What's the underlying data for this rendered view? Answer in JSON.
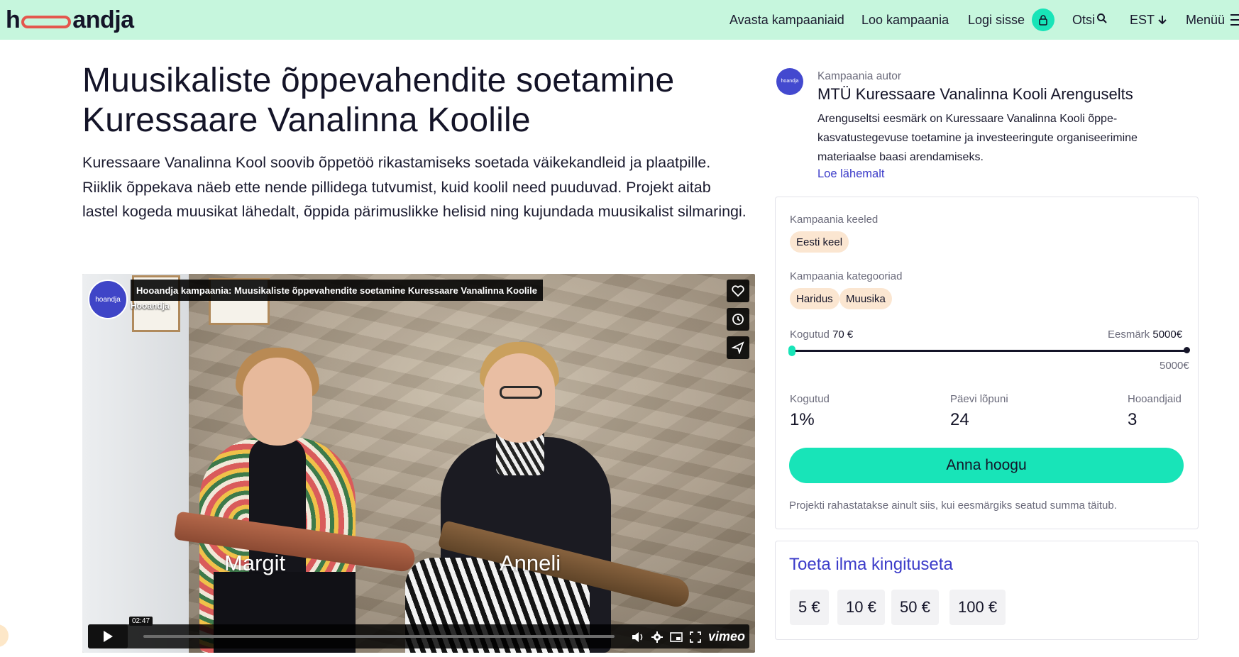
{
  "header": {
    "logo_h": "h",
    "logo_rest": "andja",
    "nav": {
      "explore": "Avasta kampaaniaid",
      "create": "Loo kampaania",
      "login": "Logi sisse",
      "search": "Otsi",
      "language": "EST",
      "menu": "Menüü"
    },
    "icons": [
      "lock-icon",
      "search-icon",
      "arrow-down-icon",
      "hamburger-icon"
    ]
  },
  "campaign": {
    "title": "Muusikaliste õppevahendite soetamine Kuressaare Vanalinna Koolile",
    "lead": "Kuressaare Vanalinna Kool soovib õppetöö rikastamiseks soetada väikekandleid ja plaatpille. Riiklik õppekava näeb ette nende pillidega tutvumist, kuid koolil need puuduvad. Projekt aitab lastel kogeda muusikat lähedalt, õppida pärimuslikke helisid ning kujundada muusikalist silmaringi."
  },
  "video": {
    "title": "Hooandja kampaania: Muusikaliste õppevahendite soetamine Kuressaare Vanalinna Koolile",
    "channel": "Hooandja",
    "avatar_text": "hoandja",
    "time": "02:47",
    "brand": "vimeo",
    "names": [
      "Margit",
      "Anneli"
    ],
    "progress_fraction": 0.0
  },
  "author": {
    "label": "Kampaania autor",
    "name": "MTÜ Kuressaare Vanalinna Kooli Arenguselts",
    "description": "Arenguseltsi eesmärk on Kuressaare Vanalinna Kooli õppe-kasvatustegevuse toetamine ja investeeringute organiseerimine materiaalse baasi arendamiseks.",
    "more": "Loe lähemalt",
    "avatar_text": "hoandja"
  },
  "funding": {
    "languages_label": "Kampaania keeled",
    "languages": [
      "Eesti keel"
    ],
    "categories_label": "Kampaania kategooriad",
    "categories": [
      "Haridus",
      "Muusika"
    ],
    "raised_label": "Kogutud",
    "raised_value": "70 €",
    "goal_label": "Eesmärk",
    "goal_value": "5000€",
    "goal_under_bar": "5000€",
    "progress_fraction": 0.014,
    "stats": [
      {
        "label": "Kogutud",
        "value": "1%"
      },
      {
        "label": "Päevi lõpuni",
        "value": "24"
      },
      {
        "label": "Hooandjaid",
        "value": "3"
      }
    ],
    "cta": "Anna hoogu",
    "note": "Projekti rahastatakse ainult siis, kui eesmärgiks seatud summa täitub."
  },
  "support": {
    "title": "Toeta ilma kingituseta",
    "amounts": [
      "5 €",
      "10 €",
      "50 €",
      "100 €"
    ]
  },
  "colors": {
    "header_bg": "#c6f6dd",
    "accent": "#18e4b8",
    "link": "#3b3bc9",
    "tag_bg": "#fbe6d1",
    "logo_ring": "#e4574e"
  }
}
